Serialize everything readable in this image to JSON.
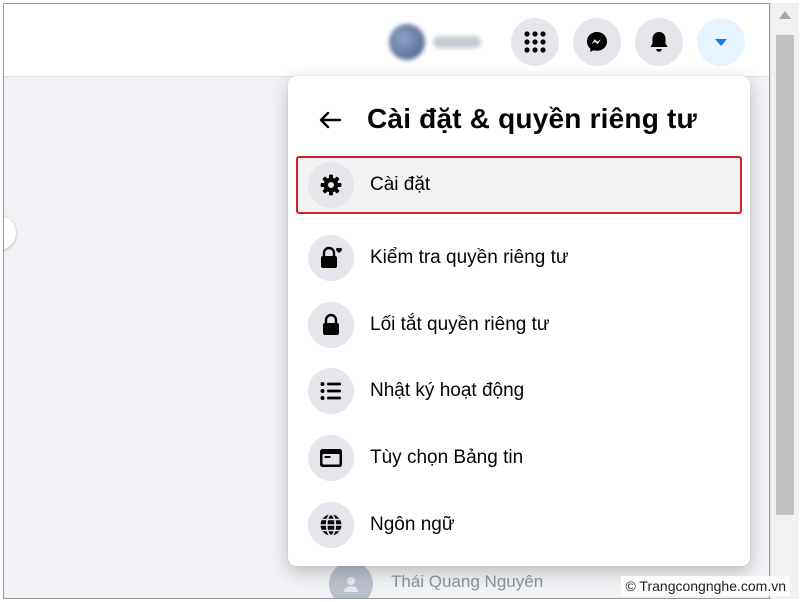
{
  "topbar": {
    "profile": {
      "name": ""
    },
    "buttons": [
      {
        "name": "menu",
        "icon": "grid-menu-icon"
      },
      {
        "name": "messenger",
        "icon": "messenger-icon"
      },
      {
        "name": "notifications",
        "icon": "bell-icon"
      },
      {
        "name": "account",
        "icon": "caret-down-icon",
        "active": true
      }
    ]
  },
  "menu": {
    "title": "Cài đặt & quyền riêng tư",
    "back_icon": "back-arrow-icon",
    "items": [
      {
        "label": "Cài đặt",
        "icon": "gear-icon",
        "highlighted": true
      },
      {
        "label": "Kiểm tra quyền riêng tư",
        "icon": "lock-heart-icon"
      },
      {
        "label": "Lối tắt quyền riêng tư",
        "icon": "lock-icon"
      },
      {
        "label": "Nhật ký hoạt động",
        "icon": "list-icon"
      },
      {
        "label": "Tùy chọn Bảng tin",
        "icon": "news-feed-icon"
      },
      {
        "label": "Ngôn ngữ",
        "icon": "globe-icon"
      }
    ]
  },
  "background": {
    "person_name": "Thái Quang Nguyên"
  },
  "watermark": "© Trangcongnghe.com.vn",
  "colors": {
    "accent": "#1877f2",
    "highlight_border": "#d0202e",
    "icon_bg": "#e4e6eb"
  }
}
